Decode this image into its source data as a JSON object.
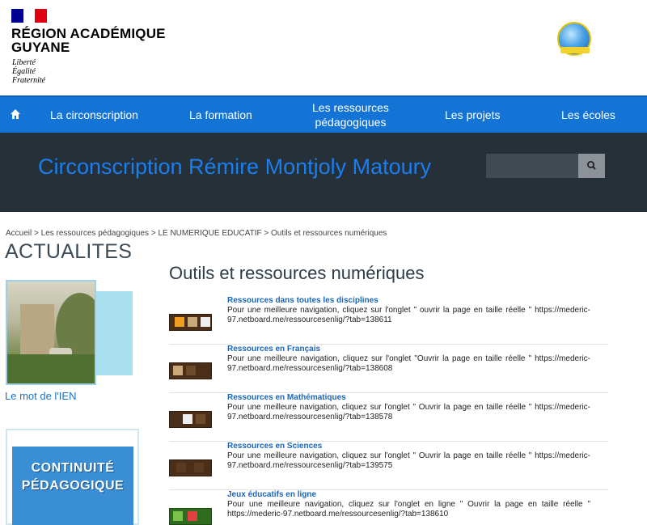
{
  "header": {
    "region_line1": "RÉGION ACADÉMIQUE",
    "region_line2": "GUYANE",
    "motto": [
      "Liberté",
      "Égalité",
      "Fraternité"
    ],
    "flag_colors": [
      "#000091",
      "#ffffff",
      "#e1000f"
    ],
    "logo_icon": "globe-logo-icon"
  },
  "nav": {
    "home_icon": "home-icon",
    "items": [
      {
        "label": "La circonscription"
      },
      {
        "label": "La formation"
      },
      {
        "label_line1": "Les ressources",
        "label_line2": "pédagogiques"
      },
      {
        "label": "Les projets"
      },
      {
        "label": "Les écoles"
      }
    ]
  },
  "banner": {
    "title": "Circonscription Rémire Montjoly Matoury",
    "search_placeholder": "",
    "search_icon": "search-icon"
  },
  "breadcrumb": "Accueil > Les ressources pédagogiques > LE NUMERIQUE EDUCATIF > Outils et ressources numériques",
  "sidebar": {
    "heading": "ACTUALITES",
    "ien_label": "Le mot de l'IEN",
    "continuite_line1": "CONTINUITÉ",
    "continuite_line2": "PÉDAGOGIQUE"
  },
  "main": {
    "title": "Outils et ressources numériques",
    "resources": [
      {
        "title": "Ressources dans toutes les disciplines",
        "description": "Pour une meilleure navigation, cliquez sur l'onglet \" ouvrir la page en taille réelle \" https://mederic-97.netboard.me/ressourcesenlig/?tab=138611"
      },
      {
        "title": "Ressources en Français",
        "description": "Pour une meilleure navigation, cliquez sur l'onglet \"Ouvrir la page en taille réelle \" https://mederic-97.netboard.me/ressourcesenlig/?tab=138608"
      },
      {
        "title": "Ressources en Mathématiques",
        "description": "Pour une meilleure navigation, cliquez sur l'onglet \" Ouvrir la page en taille réelle \" https://mederic-97.netboard.me/ressourcesenlig/?tab=138578"
      },
      {
        "title": "Ressources en Sciences",
        "description": "Pour une meilleure navigation, cliquez sur l'onglet \" Ouvrir la page en taille réelle \" https://mederic-97.netboard.me/ressourcesenlig/?tab=139575"
      },
      {
        "title": "Jeux éducatifs en ligne",
        "description": "Pour une meilleure navigation, cliquez sur l'onglet en ligne \" Ouvrir la page en taille réelle \" https://mederic-97.netboard.me/ressourcesenlig/?tab=138610"
      }
    ]
  }
}
